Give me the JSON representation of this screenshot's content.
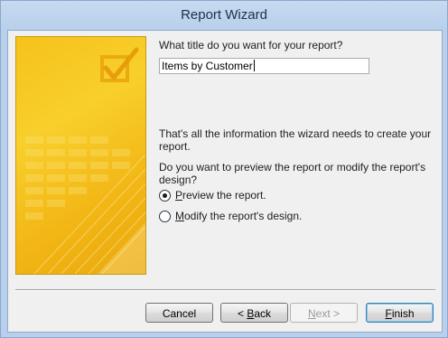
{
  "window": {
    "title": "Report Wizard"
  },
  "prompt": {
    "title_question": "What title do you want for your report?",
    "title_value": "Items by Customer",
    "info_text_line1": "That's all the information the wizard needs to create your",
    "info_text_line2": "report.",
    "preview_question_line1": "Do you want to preview the report or modify the report's",
    "preview_question_line2": "design?"
  },
  "options": {
    "preview": {
      "accel": "P",
      "rest": "review the report.",
      "selected": true
    },
    "modify": {
      "accel": "M",
      "rest": "odify the report's design.",
      "selected": false
    }
  },
  "buttons": {
    "cancel": "Cancel",
    "back_prefix": "< ",
    "back_accel": "B",
    "back_rest": "ack",
    "next_accel": "N",
    "next_rest": "ext >",
    "finish_accel": "F",
    "finish_rest": "inish"
  },
  "icons": {
    "banner": "checkbox-check-icon"
  },
  "colors": {
    "banner_yellow": "#f6c21a",
    "title_bar": "#b9d0ec"
  }
}
